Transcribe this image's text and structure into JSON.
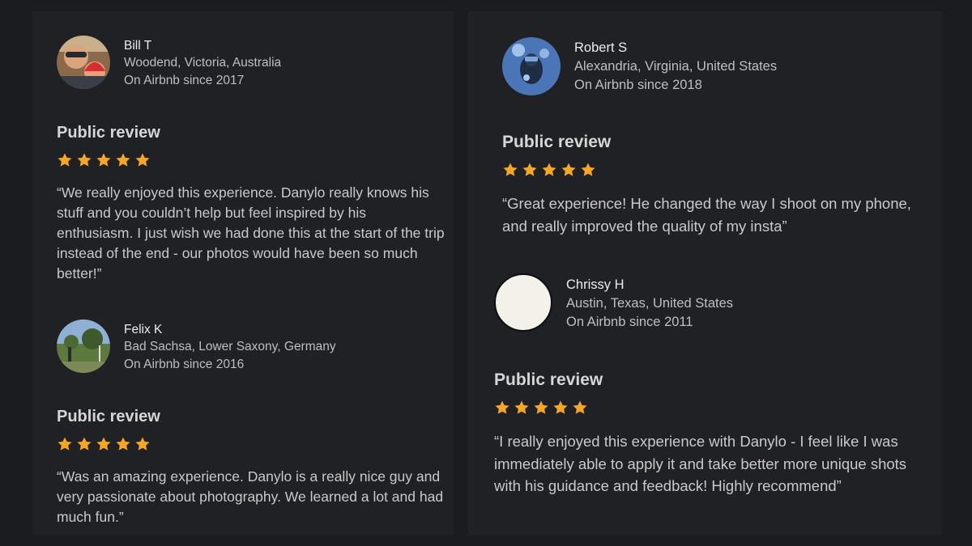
{
  "star_color": "#f5a623",
  "reviews": [
    {
      "name": "Bill T",
      "location": "Woodend, Victoria, Australia",
      "since": "On Airbnb since 2017",
      "review_title": "Public review",
      "rating": 5,
      "text": "“We really enjoyed this experience. Danylo really knows his stuff and you couldn’t help but feel inspired by his enthusiasm. I just wish we had done this at the start of the trip instead of the end - our photos would have been so much better!”"
    },
    {
      "name": "Felix K",
      "location": "Bad Sachsa, Lower Saxony, Germany",
      "since": "On Airbnb since 2016",
      "review_title": "Public review",
      "rating": 5,
      "text": "“Was an amazing experience. Danylo is a really nice guy and very passionate about photography. We learned a lot and had much fun.”"
    },
    {
      "name": "Robert S",
      "location": "Alexandria, Virginia, United States",
      "since": "On Airbnb since 2018",
      "review_title": "Public review",
      "rating": 5,
      "text": "“Great experience! He changed the way I shoot on my phone, and really improved the quality of my insta”"
    },
    {
      "name": "Chrissy H",
      "location": "Austin, Texas, United States",
      "since": "On Airbnb since 2011",
      "review_title": "Public review",
      "rating": 5,
      "text": "“I really enjoyed this experience with Danylo - I feel like I was immediately able to apply it and take better more unique shots with his guidance and feedback! Highly recommend”"
    }
  ]
}
